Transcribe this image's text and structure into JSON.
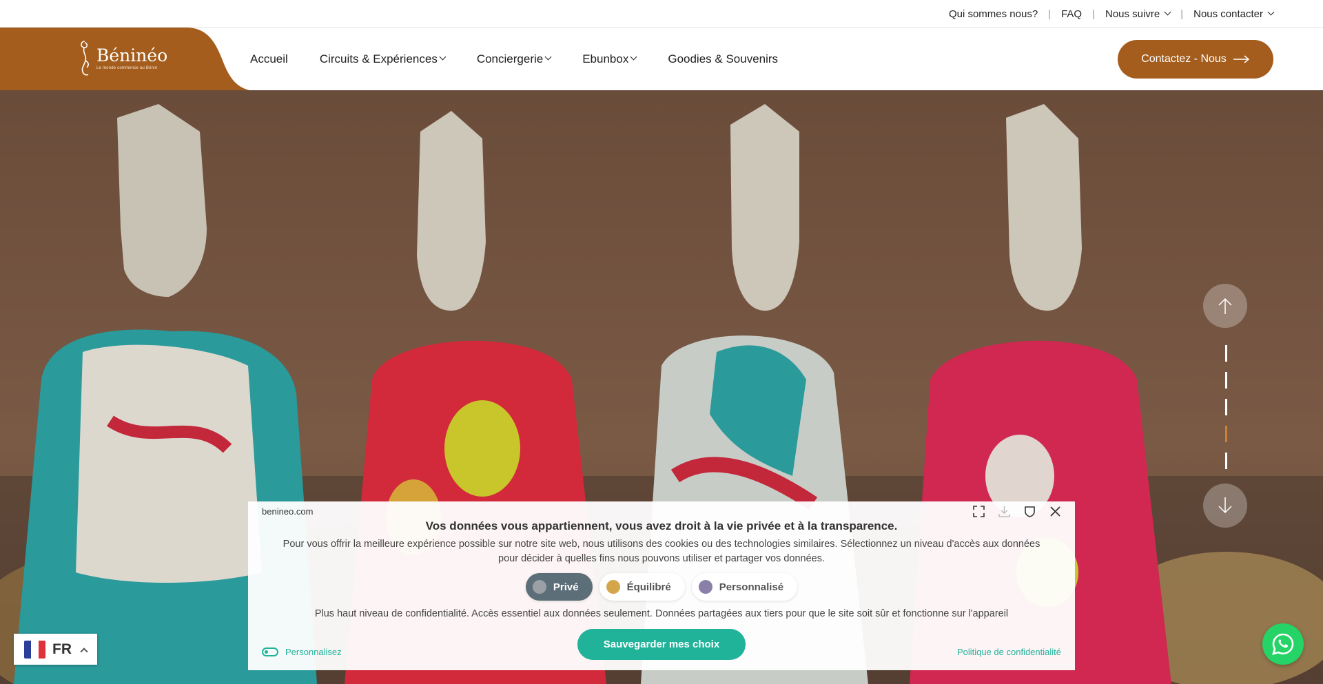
{
  "topbar": {
    "links": [
      {
        "label": "Qui sommes nous?",
        "dropdown": false
      },
      {
        "label": "FAQ",
        "dropdown": false
      },
      {
        "label": "Nous suivre",
        "dropdown": true
      },
      {
        "label": "Nous contacter",
        "dropdown": true
      }
    ],
    "separator": "|"
  },
  "header": {
    "logo": {
      "name": "Béninéo",
      "tagline": "Le monde commence au Bénin"
    },
    "nav": [
      {
        "label": "Accueil",
        "dropdown": false
      },
      {
        "label": "Circuits & Expériences",
        "dropdown": true
      },
      {
        "label": "Conciergerie",
        "dropdown": true
      },
      {
        "label": "Ebunbox",
        "dropdown": true
      },
      {
        "label": "Goodies & Souvenirs",
        "dropdown": false
      }
    ],
    "cta_label": "Contactez - Nous",
    "brand_color": "#a45d1c"
  },
  "hero": {
    "slider": {
      "count": 5,
      "active_index": 4
    },
    "scroll_up_icon": "arrow-up-icon",
    "scroll_down_icon": "arrow-down-icon"
  },
  "cookie_banner": {
    "domain": "benineo.com",
    "title": "Vos données vous appartiennent, vous avez droit à la vie privée et à la transparence.",
    "description": "Pour vous offrir la meilleure expérience possible sur notre site web, nous utilisons des cookies ou des technologies similaires. Sélectionnez un niveau d'accès aux données pour décider à quelles fins nous pouvons utiliser et partager vos données.",
    "levels": [
      {
        "label": "Privé",
        "color": "#9aa0a6",
        "selected": true
      },
      {
        "label": "Équilibré",
        "color": "#d4a64a",
        "selected": false
      },
      {
        "label": "Personnalisé",
        "color": "#8a7fa8",
        "selected": false
      }
    ],
    "level_description": "Plus haut niveau de confidentialité. Accès essentiel aux données seulement. Données partagées aux tiers pour que le site soit sûr et fonctionne sur l'appareil",
    "save_label": "Sauvegarder mes choix",
    "customize_label": "Personnalisez",
    "policy_label": "Politique de confidentialité",
    "accent_color": "#21b29a"
  },
  "language": {
    "code": "FR",
    "flag_icon": "france-flag-icon"
  },
  "whatsapp": {
    "icon": "whatsapp-icon",
    "color": "#25d366"
  }
}
